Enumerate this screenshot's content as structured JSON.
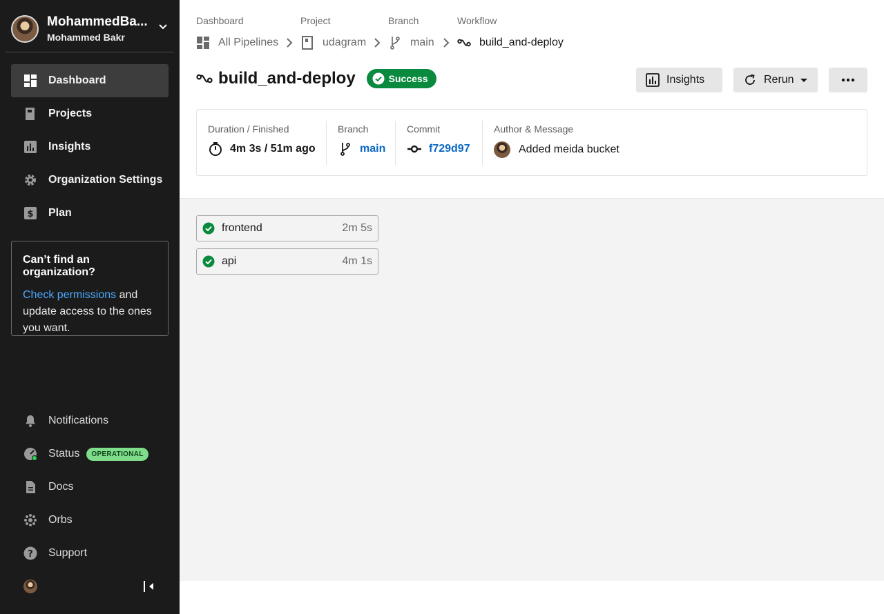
{
  "sidebar": {
    "org": {
      "name": "MohammedBakr",
      "display_name": "MohammedBa...",
      "subtitle": "Mohammed Bakr"
    },
    "nav": [
      {
        "label": "Dashboard",
        "icon": "dashboard-icon",
        "active": true
      },
      {
        "label": "Projects",
        "icon": "projects-icon",
        "active": false
      },
      {
        "label": "Insights",
        "icon": "insights-icon",
        "active": false
      },
      {
        "label": "Organization Settings",
        "icon": "gear-icon",
        "active": false
      },
      {
        "label": "Plan",
        "icon": "dollar-icon",
        "active": false
      }
    ],
    "org_help": {
      "title": "Can’t find an organization?",
      "link": "Check permissions",
      "text": " and update access to the ones you want."
    },
    "bottom_nav": [
      {
        "label": "Notifications",
        "icon": "bell-icon"
      },
      {
        "label": "Status",
        "icon": "status-icon",
        "badge": "OPERATIONAL"
      },
      {
        "label": "Docs",
        "icon": "docs-icon"
      },
      {
        "label": "Orbs",
        "icon": "orbs-icon"
      },
      {
        "label": "Support",
        "icon": "help-icon"
      }
    ]
  },
  "breadcrumb": [
    {
      "label": "Dashboard",
      "value": "All Pipelines",
      "icon": "pipelines-icon"
    },
    {
      "label": "Project",
      "value": "udagram",
      "icon": "repo-icon"
    },
    {
      "label": "Branch",
      "value": "main",
      "icon": "branch-icon"
    },
    {
      "label": "Workflow",
      "value": "build_and-deploy",
      "icon": "workflow-icon"
    }
  ],
  "workflow": {
    "title": "build_and-deploy",
    "status": "Success",
    "actions": {
      "insights": "Insights",
      "rerun": "Rerun"
    }
  },
  "details": {
    "duration_label": "Duration / Finished",
    "duration_value": "4m 3s / 51m ago",
    "branch_label": "Branch",
    "branch_value": "main",
    "commit_label": "Commit",
    "commit_value": "f729d97",
    "author_label": "Author & Message",
    "message": "Added meida bucket"
  },
  "jobs": [
    {
      "name": "frontend",
      "duration": "2m 5s",
      "status": "success"
    },
    {
      "name": "api",
      "duration": "4m 1s",
      "status": "success"
    }
  ],
  "colors": {
    "sidebar_bg": "#1b1b1b",
    "success": "#0a8a3e",
    "link": "#0a67c2",
    "badge": "#7edc8a"
  }
}
